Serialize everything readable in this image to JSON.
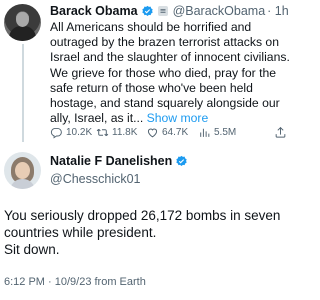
{
  "original_tweet": {
    "author_name": "Barack Obama",
    "handle": "@BarackObama",
    "time": "· 1h",
    "text": "All Americans should be horrified and outraged by the brazen terrorist attacks on Israel and the slaughter of innocent civilians. We grieve for those who died, pray for the safe return of those who've been held hostage, and stand squarely alongside our ally, Israel, as it... ",
    "show_more": "Show more",
    "replies": "10.2K",
    "retweets": "11.8K",
    "likes": "64.7K",
    "views": "5.5M"
  },
  "reply_tweet": {
    "author_name": "Natalie F Danelishen",
    "handle": "@Chesschick01",
    "text_lines": [
      "You seriously dropped 26,172 bombs in seven countries while president.",
      "Sit down."
    ],
    "timestamp": "6:12 PM · 10/9/23 from Earth"
  },
  "colors": {
    "accent": "#1d9bf0",
    "secondary_text": "#536471",
    "verified": "#1d9bf0"
  },
  "icons": [
    "verified-badge-icon",
    "government-badge-icon",
    "reply-icon",
    "retweet-icon",
    "like-icon",
    "views-icon",
    "share-icon"
  ]
}
